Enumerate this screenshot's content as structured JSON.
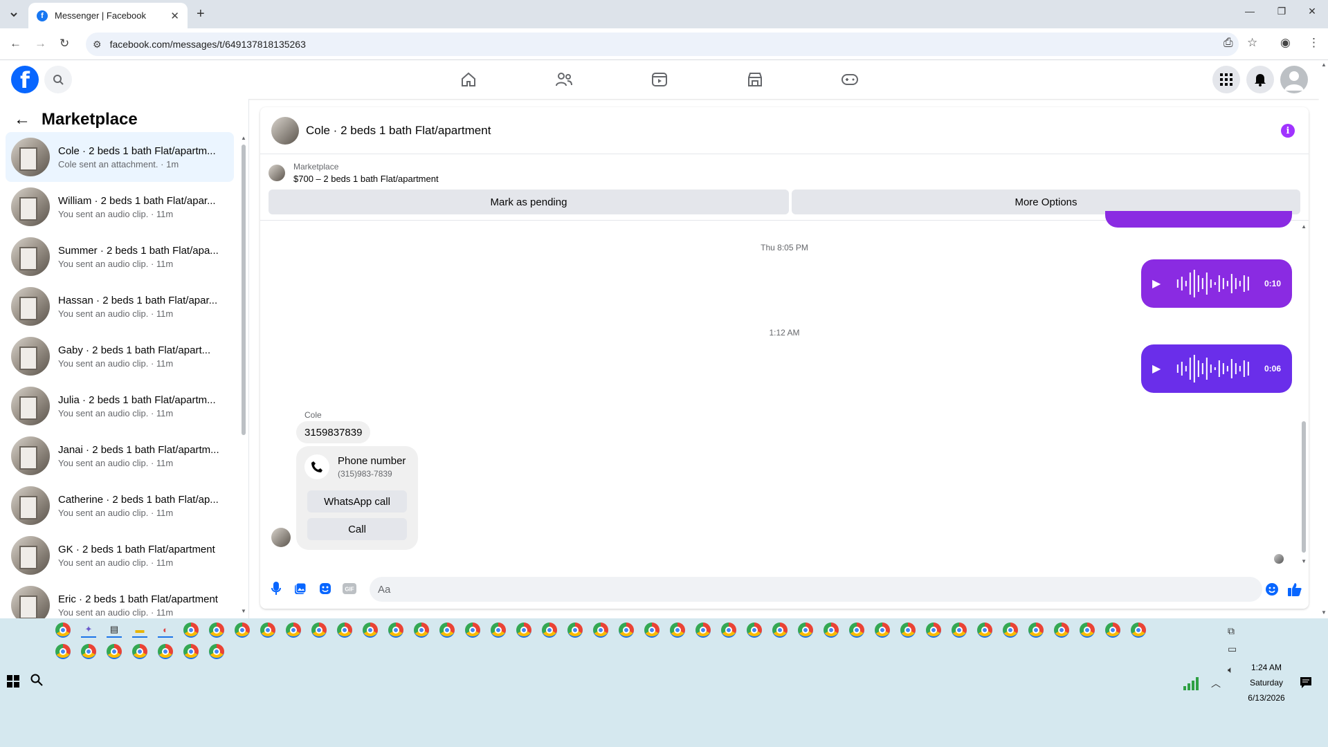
{
  "browser": {
    "tab_title": "Messenger | Facebook",
    "url": "facebook.com/messages/t/649137818135263"
  },
  "sidebar": {
    "title": "Marketplace",
    "conversations": [
      {
        "name": "Cole · 2 beds 1 bath Flat/apartm...",
        "sub": "Cole sent an attachment. · 1m",
        "active": true
      },
      {
        "name": "William · 2 beds 1 bath Flat/apar...",
        "sub": "You sent an audio clip. · 11m"
      },
      {
        "name": "Summer · 2 beds 1 bath Flat/apa...",
        "sub": "You sent an audio clip. · 11m"
      },
      {
        "name": "Hassan · 2 beds 1 bath Flat/apar...",
        "sub": "You sent an audio clip. · 11m"
      },
      {
        "name": "Gaby · 2 beds 1 bath Flat/apart...",
        "sub": "You sent an audio clip. · 11m"
      },
      {
        "name": "Julia · 2 beds 1 bath Flat/apartm...",
        "sub": "You sent an audio clip. · 11m"
      },
      {
        "name": "Janai · 2 beds 1 bath Flat/apartm...",
        "sub": "You sent an audio clip. · 11m"
      },
      {
        "name": "Catherine · 2 beds 1 bath Flat/ap...",
        "sub": "You sent an audio clip. · 11m"
      },
      {
        "name": "GK · 2 beds 1 bath Flat/apartment",
        "sub": "You sent an audio clip. · 11m"
      },
      {
        "name": "Eric · 2 beds 1 bath Flat/apartment",
        "sub": "You sent an audio clip. · 11m"
      }
    ]
  },
  "chat": {
    "title": "Cole · 2 beds 1 bath Flat/apartment",
    "marketplace_label": "Marketplace",
    "listing": "$700 – 2 beds 1 bath Flat/apartment",
    "pending_button": "Mark as pending",
    "options_button": "More Options",
    "timestamp1": "Thu 8:05 PM",
    "audio1_duration": "0:10",
    "timestamp2": "1:12 AM",
    "audio2_duration": "0:06",
    "sender": "Cole",
    "phone_message": "3159837839",
    "phone_card_title": "Phone number",
    "phone_card_value": "(315)983-7839",
    "whatsapp_button": "WhatsApp call",
    "call_button": "Call",
    "composer_placeholder": "Aa"
  },
  "taskbar": {
    "time": "1:24 AM",
    "day": "Saturday",
    "date": "6/13/2026"
  },
  "colors": {
    "audio1": "#8a2be2",
    "audio2": "#6a2eea",
    "fb_blue": "#0866ff",
    "messenger_purple": "#a033ff"
  }
}
